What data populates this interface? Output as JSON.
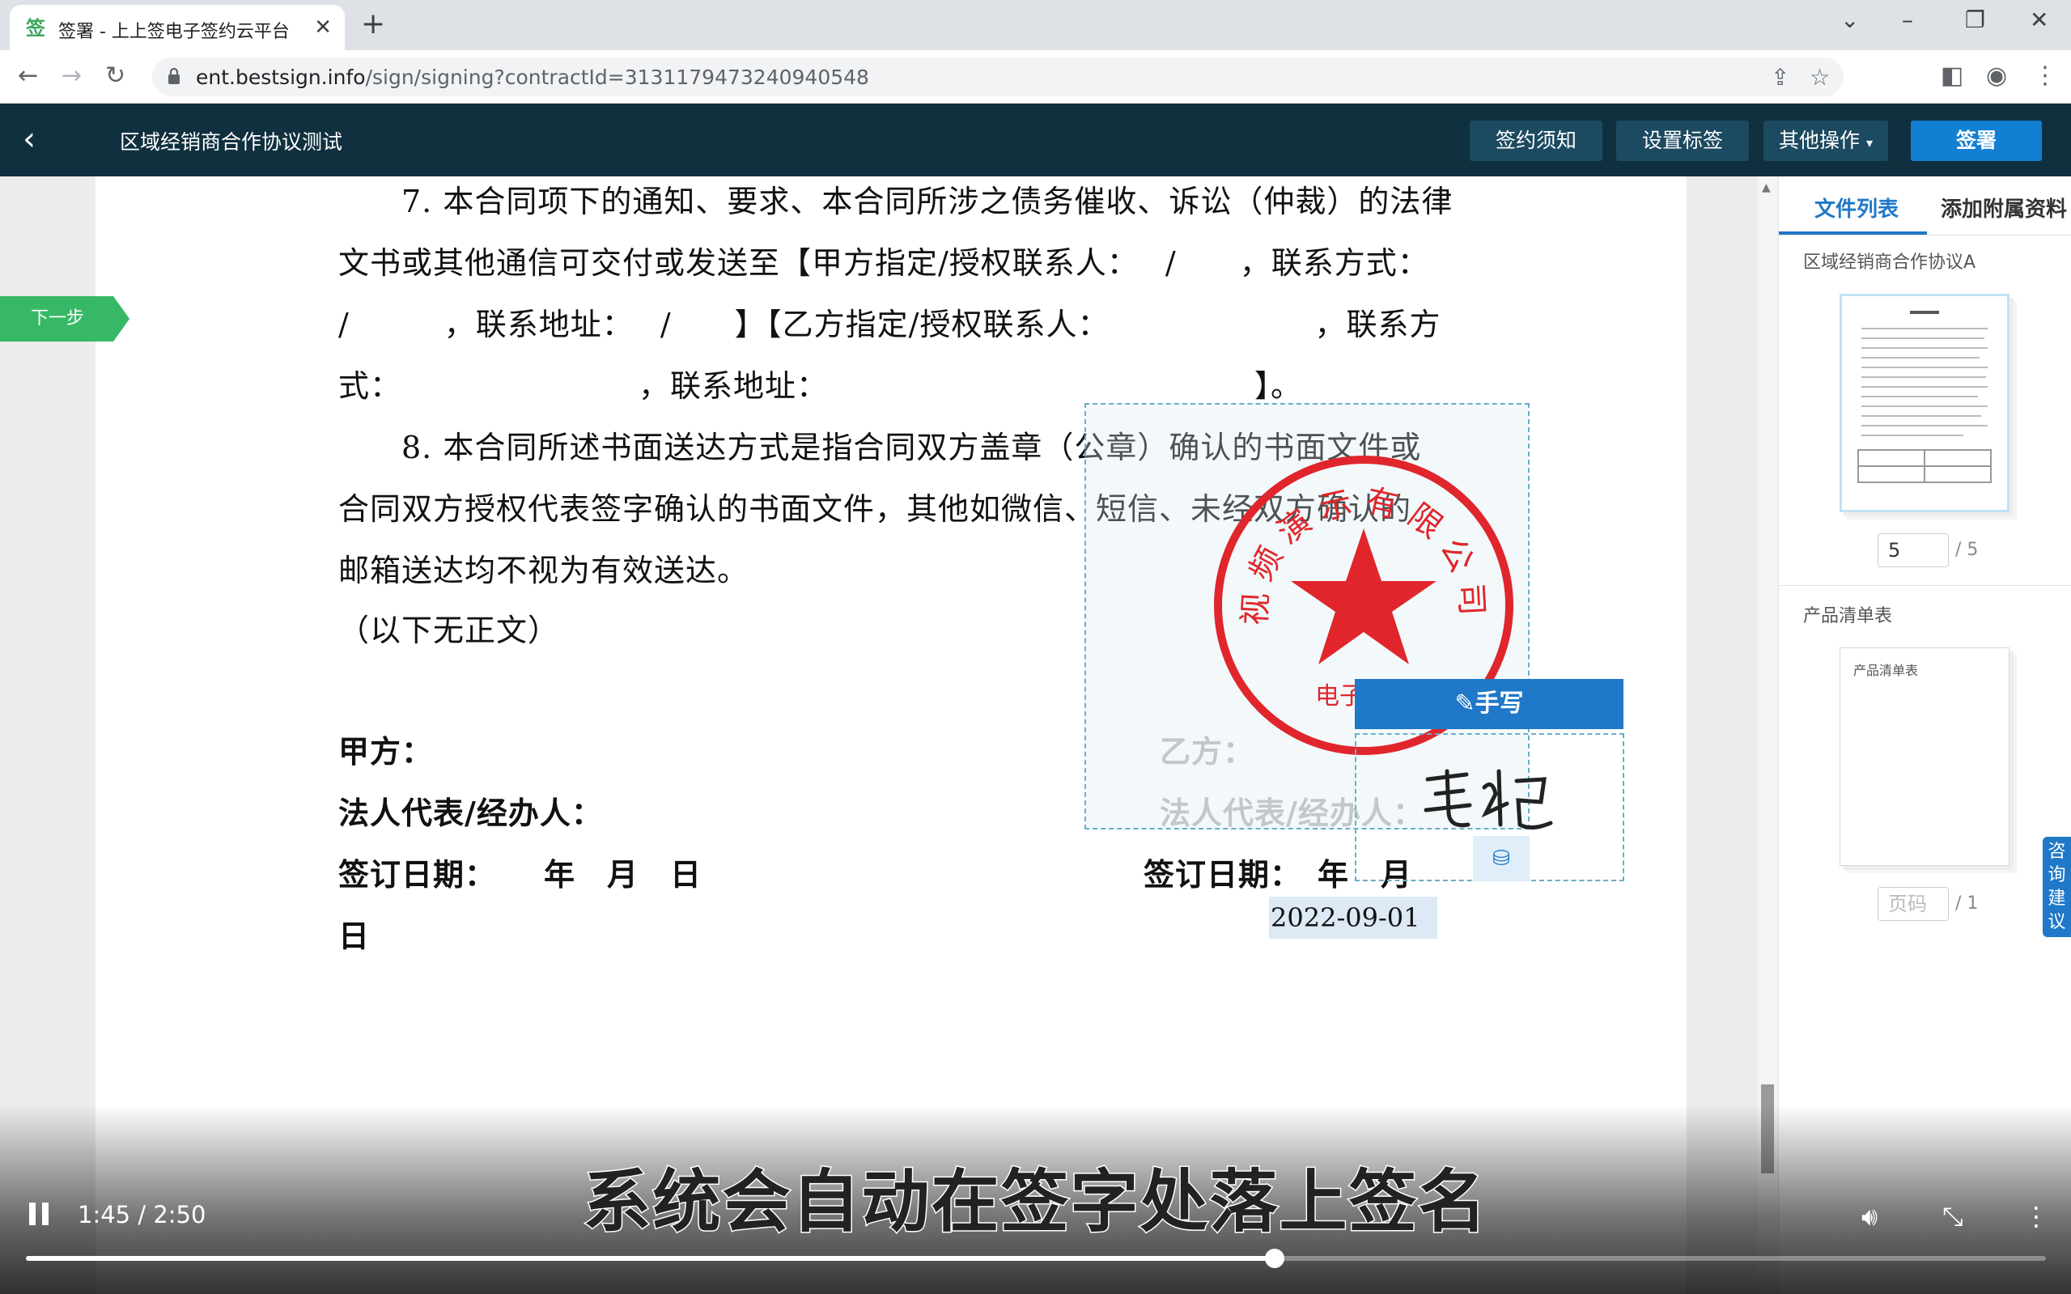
{
  "browser": {
    "tab_title": "签署 - 上上签电子签约云平台",
    "tab_favicon": "签",
    "new_tab": "+",
    "url_main": "ent.bestsign.info",
    "url_rest": "/sign/signing?contractId=3131179473240940548"
  },
  "header": {
    "title": "区域经销商合作协议测试",
    "btn_notice": "签约须知",
    "btn_labels": "设置标签",
    "btn_more": "其他操作",
    "btn_sign": "签署"
  },
  "document": {
    "next_step": "下一步",
    "lines": [
      "7. 本合同项下的通知、要求、本合同所涉之债务催收、诉讼（仲裁）的法律",
      "文书或其他通信可交付或发送至【甲方指定/授权联系人：　 /　　，联系方式：",
      "/　　　，联系地址：　 /　　】【乙方指定/授权联系人：　　　　　　　，联系方",
      "式：　　　　　　　　，联系地址：　　　　　　　　　　　　　　】。",
      "8. 本合同所述书面送达方式是指合同双方盖章（公章）确认的书面文件或",
      "合同双方授权代表签字确认的书面文件，其他如微信、短信、未经双方确认的",
      "邮箱送达均不视为有效送达。",
      "（以下无正文）"
    ],
    "party_a": "甲方：",
    "party_a_rep": "法人代表/经办人：",
    "party_a_date": "签订日期：　　年　月　日",
    "party_a_date_tail": "日",
    "party_b": "乙方：",
    "party_b_rep": "法人代表/经办人：",
    "party_b_date": "签订日期：　年　月",
    "seal_text": "视频演示有限公司",
    "seal_subtext": "电子",
    "handwrite_label": "手写",
    "signature": "毛妃",
    "date_value": "2022-09-01"
  },
  "consult_tab": [
    "咨",
    "询",
    "建",
    "议"
  ],
  "sidebar": {
    "tab_files": "文件列表",
    "tab_attach": "添加附属资料",
    "file1_name": "区域经销商合作协议A",
    "file1_page": "5",
    "file1_total": "/ 5",
    "file2_name": "产品清单表",
    "file2_page_placeholder": "页码",
    "file2_total": "/ 1",
    "file2_thumb_text": "产品清单表"
  },
  "video": {
    "subtitle": "系统会自动在签字处落上签名",
    "time": "1:45 / 2:50",
    "progress": 0.618
  },
  "colors": {
    "header_bg": "#10303f",
    "accent": "#127fd2",
    "next_step": "#37b866",
    "seal": "#e0262c"
  }
}
